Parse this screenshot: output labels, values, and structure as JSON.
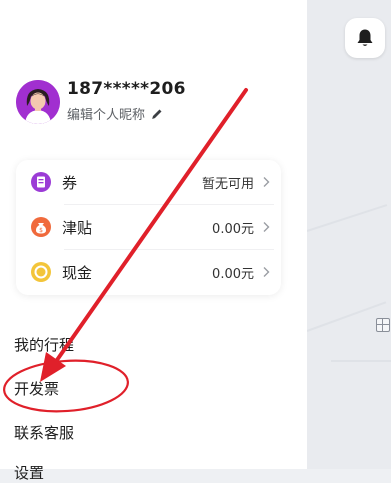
{
  "profile": {
    "phone": "187*****206",
    "edit_nickname": "编辑个人昵称",
    "avatar_icon": "user-avatar-icon",
    "edit_icon": "pencil-icon"
  },
  "wallet": {
    "items": [
      {
        "label": "券",
        "value": "暂无可用",
        "icon": "coupon-icon"
      },
      {
        "label": "津贴",
        "value": "0.00元",
        "icon": "money-bag-icon"
      },
      {
        "label": "现金",
        "value": "0.00元",
        "icon": "coin-icon"
      }
    ]
  },
  "menu": {
    "items": [
      {
        "label": "我的行程"
      },
      {
        "label": "开发票"
      },
      {
        "label": "联系客服"
      },
      {
        "label": "设置"
      }
    ]
  },
  "map": {
    "bell_icon": "bell-icon",
    "marker_icon": "map-grid-marker-icon"
  },
  "annotation": {
    "arrow_color": "#e0202a",
    "circle_color": "#e0202a"
  }
}
